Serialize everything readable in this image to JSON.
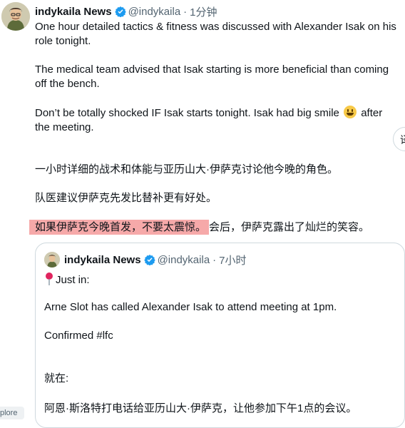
{
  "tweet": {
    "author_name": "indykaila News",
    "handle": "@indykaila",
    "separator": "·",
    "time": "1分钟",
    "p1": "One hour detailed tactics & fitness was discussed with Alexander Isak on his role tonight.",
    "p2": "The medical team advised that Isak starting is more beneficial than coming off the bench.",
    "p3_before_emoji": "Don’t be totally shocked IF Isak starts tonight. Isak had big smile ",
    "p3_emoji": "smiley-emoji",
    "p3_after_emoji": " after the meeting.",
    "zh1": "一小时详细的战术和体能与亚历山大·伊萨克讨论他今晚的角色。",
    "zh2": "队医建议伊萨克先发比替补更有好处。",
    "zh3_highlight": "如果伊萨克今晚首发，不要太震惊。",
    "zh3_rest": "会后，伊萨克露出了灿烂的笑容。",
    "highlight_color": "#f6a9a9"
  },
  "side_button": {
    "label": "译"
  },
  "quoted_tweet": {
    "author_name": "indykaila News",
    "handle": "@indykaila",
    "separator": "·",
    "time": "7小时",
    "line1": "Just in:",
    "line1_icon": "pin-icon",
    "line2": "Arne Slot has called Alexander Isak to attend meeting at 1pm.",
    "line3": "Confirmed #lfc",
    "line4": "就在:",
    "line5": "阿恩·斯洛特打电话给亚历山大·伊萨克，让他参加下午1点的会议。"
  },
  "explore_tab": {
    "label": "plore"
  },
  "colors": {
    "verified": "#1d9bf0",
    "secondary_text": "#536471",
    "border": "#cfd9de"
  }
}
